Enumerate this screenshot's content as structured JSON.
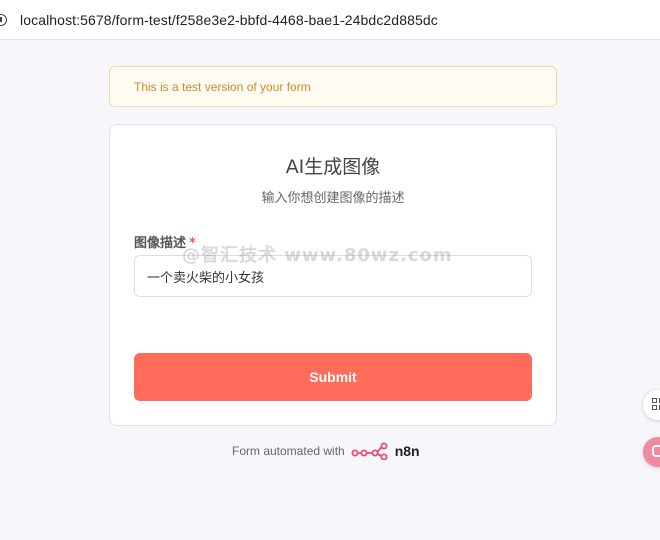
{
  "browser": {
    "url": "localhost:5678/form-test/f258e3e2-bbfd-4468-bae1-24bdc2d885dc"
  },
  "banner": {
    "text": "This is a test version of your form"
  },
  "form": {
    "title": "AI生成图像",
    "subtitle": "输入你想创建图像的描述",
    "field_label": "图像描述",
    "required_mark": "*",
    "field_value": "一个卖火柴的小女孩",
    "submit_label": "Submit"
  },
  "footer": {
    "text": "Form automated with",
    "brand": "n8n"
  },
  "watermark": {
    "text": "@智汇技术 www.80wz.com"
  },
  "colors": {
    "accent": "#ff6d5a",
    "banner_text": "#c98c2a",
    "required": "#e35d4a"
  },
  "icons": {
    "site_info": "info-icon",
    "n8n_logo": "n8n-logo-icon",
    "side_grid": "grid-icon",
    "side_bot": "assistant-icon"
  }
}
